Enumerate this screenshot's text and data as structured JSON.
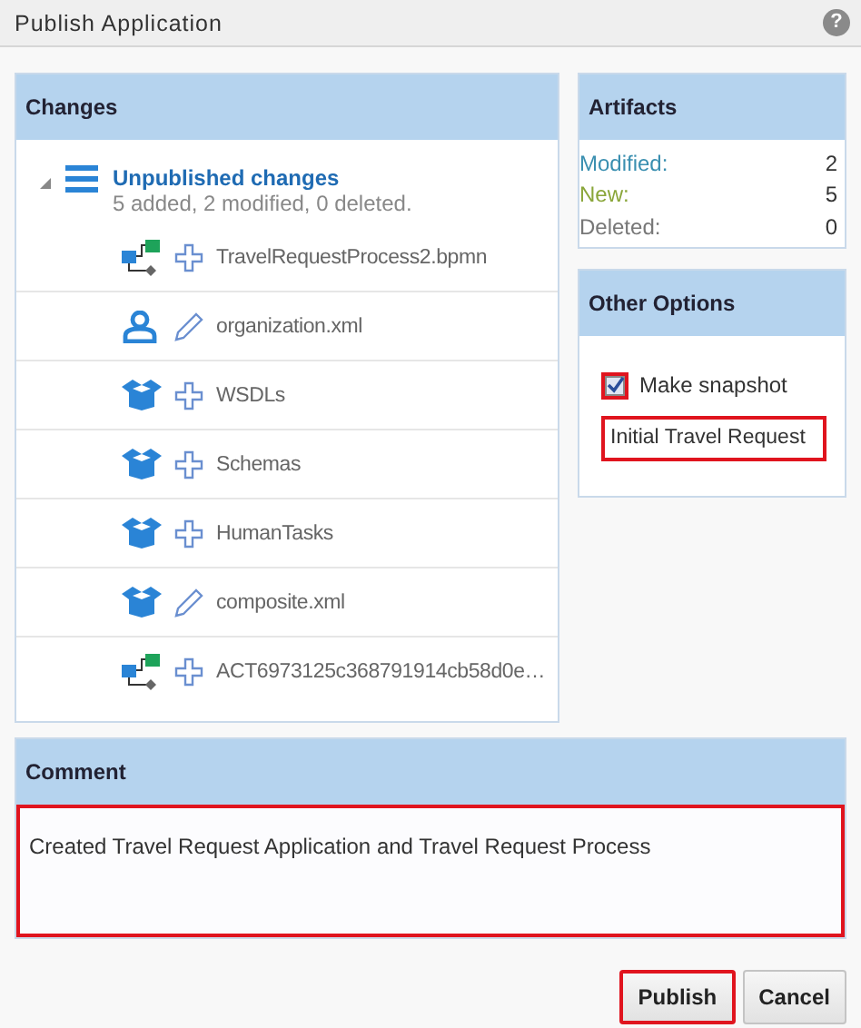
{
  "window": {
    "title": "Publish Application",
    "help": "?"
  },
  "changes": {
    "title": "Changes",
    "root": {
      "label": "Unpublished changes",
      "summary": "5 added, 2 modified, 0 deleted.",
      "expanded": true,
      "children": [
        {
          "label": "TravelRequestProcess2.bpmn",
          "kind": "process",
          "modified": false
        },
        {
          "label": "organization.xml",
          "kind": "organization",
          "modified": true
        },
        {
          "label": "WSDLs",
          "kind": "package",
          "modified": false
        },
        {
          "label": "Schemas",
          "kind": "package",
          "modified": false
        },
        {
          "label": "HumanTasks",
          "kind": "package",
          "modified": false
        },
        {
          "label": "composite.xml",
          "kind": "package",
          "modified": true
        },
        {
          "label": "ACT6973125c368791914cb58d0e…",
          "kind": "process",
          "modified": false
        }
      ]
    }
  },
  "artifacts": {
    "title": "Artifacts",
    "rows": [
      {
        "label": "Modified:",
        "value": "2",
        "color": "#3a8fb0"
      },
      {
        "label": "New:",
        "value": "5",
        "color": "#8aa63a"
      },
      {
        "label": "Deleted:",
        "value": "0",
        "color": "#777777"
      }
    ]
  },
  "other_options": {
    "title": "Other Options",
    "snapshot": {
      "label": "Make snapshot",
      "checked": true,
      "highlighted": true
    },
    "snapshot_name": {
      "value": "Initial Travel Request",
      "highlighted": true
    }
  },
  "comment": {
    "title": "Comment",
    "value": "Created Travel Request Application and Travel Request Process",
    "highlighted": true
  },
  "buttons": [
    {
      "label": "Publish",
      "highlighted": true
    },
    {
      "label": "Cancel",
      "highlighted": false
    }
  ]
}
